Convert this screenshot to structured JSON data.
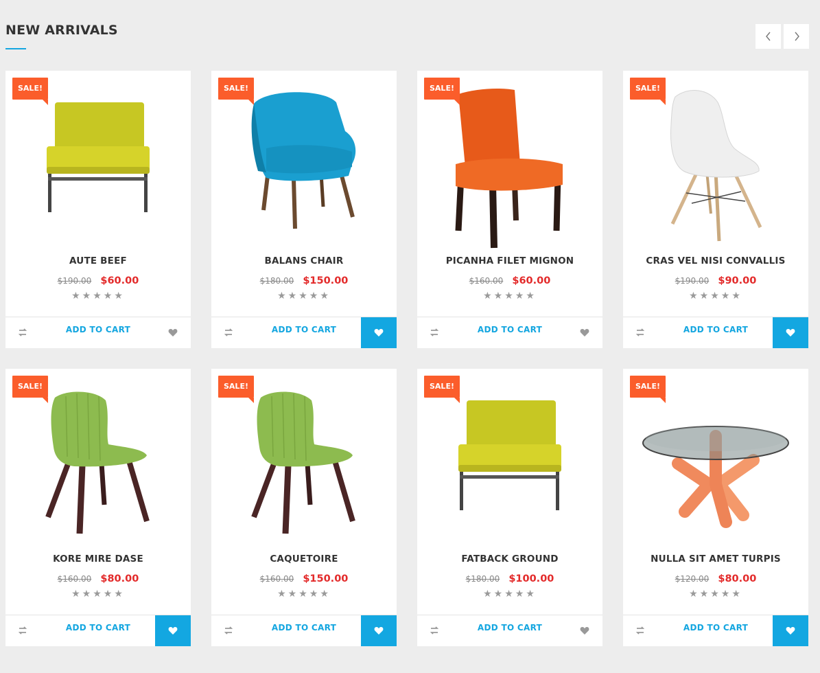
{
  "section": {
    "title": "NEW ARRIVALS"
  },
  "nav": {
    "prev_icon": "chevron-left-icon",
    "next_icon": "chevron-right-icon"
  },
  "colors": {
    "accent": "#14a6e0",
    "sale": "#fb5d2b",
    "price": "#e32b2b",
    "wish_active": "#13a7e1"
  },
  "products": [
    {
      "badge": "SALE!",
      "name": "AUTE BEEF",
      "old_price": "$190.00",
      "price": "$60.00",
      "rating_stars": "★★★★★",
      "cart_label": "ADD TO CART",
      "wishlist_active": false,
      "image": "yellow-lounge-chair"
    },
    {
      "badge": "SALE!",
      "name": "BALANS CHAIR",
      "old_price": "$180.00",
      "price": "$150.00",
      "rating_stars": "★★★★★",
      "cart_label": "ADD TO CART",
      "wishlist_active": true,
      "image": "blue-armchair"
    },
    {
      "badge": "SALE!",
      "name": "PICANHA FILET MIGNON",
      "old_price": "$160.00",
      "price": "$60.00",
      "rating_stars": "★★★★★",
      "cart_label": "ADD TO CART",
      "wishlist_active": false,
      "image": "orange-dining-chair"
    },
    {
      "badge": "SALE!",
      "name": "CRAS VEL NISI CONVALLIS",
      "old_price": "$190.00",
      "price": "$90.00",
      "rating_stars": "★★★★★",
      "cart_label": "ADD TO CART",
      "wishlist_active": true,
      "image": "white-eames-chair"
    },
    {
      "badge": "SALE!",
      "name": "KORE MIRE DASE",
      "old_price": "$160.00",
      "price": "$80.00",
      "rating_stars": "★★★★★",
      "cart_label": "ADD TO CART",
      "wishlist_active": true,
      "image": "green-wood-chair"
    },
    {
      "badge": "SALE!",
      "name": "CAQUETOIRE",
      "old_price": "$160.00",
      "price": "$150.00",
      "rating_stars": "★★★★★",
      "cart_label": "ADD TO CART",
      "wishlist_active": true,
      "image": "green-wood-chair"
    },
    {
      "badge": "SALE!",
      "name": "FATBACK GROUND",
      "old_price": "$180.00",
      "price": "$100.00",
      "rating_stars": "★★★★★",
      "cart_label": "ADD TO CART",
      "wishlist_active": false,
      "image": "yellow-lounge-chair"
    },
    {
      "badge": "SALE!",
      "name": "NULLA SIT AMET TURPIS",
      "old_price": "$120.00",
      "price": "$80.00",
      "rating_stars": "★★★★★",
      "cart_label": "ADD TO CART",
      "wishlist_active": true,
      "image": "glass-table"
    }
  ]
}
